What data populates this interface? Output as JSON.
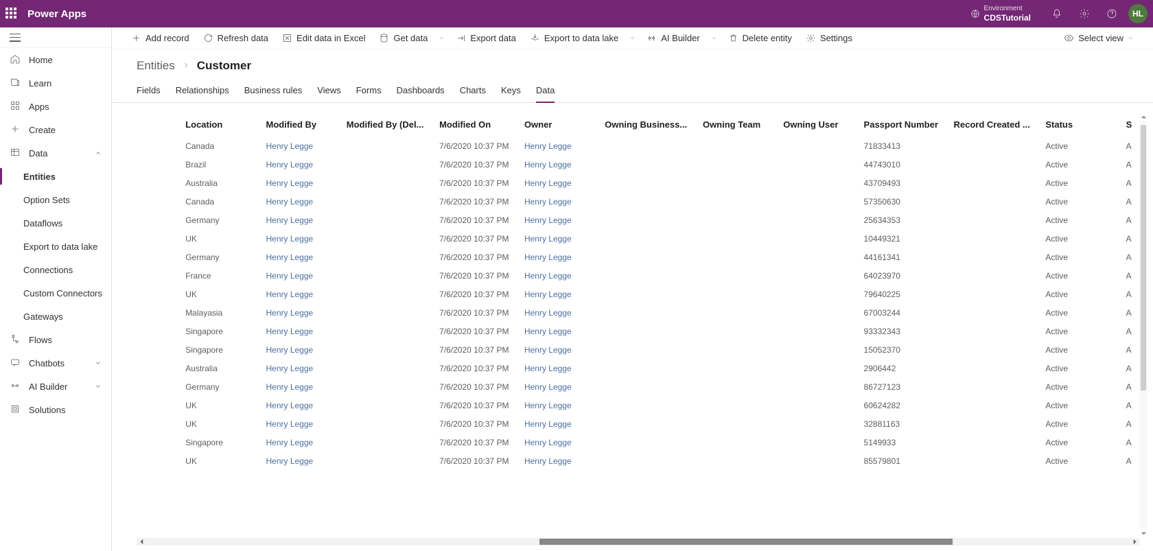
{
  "app_title": "Power Apps",
  "environment": {
    "label": "Environment",
    "name": "CDSTutorial"
  },
  "avatar_initials": "HL",
  "sidebar": {
    "items": [
      {
        "label": "Home"
      },
      {
        "label": "Learn"
      },
      {
        "label": "Apps"
      },
      {
        "label": "Create"
      },
      {
        "label": "Data",
        "expanded": true,
        "children": [
          {
            "label": "Entities",
            "active": true
          },
          {
            "label": "Option Sets"
          },
          {
            "label": "Dataflows"
          },
          {
            "label": "Export to data lake"
          },
          {
            "label": "Connections"
          },
          {
            "label": "Custom Connectors"
          },
          {
            "label": "Gateways"
          }
        ]
      },
      {
        "label": "Flows"
      },
      {
        "label": "Chatbots",
        "chevron": true
      },
      {
        "label": "AI Builder",
        "chevron": true
      },
      {
        "label": "Solutions"
      }
    ]
  },
  "command_bar": {
    "add_record": "Add record",
    "refresh": "Refresh data",
    "edit_excel": "Edit data in Excel",
    "get_data": "Get data",
    "export_data": "Export data",
    "export_lake": "Export to data lake",
    "ai_builder": "AI Builder",
    "delete_entity": "Delete entity",
    "settings": "Settings",
    "select_view": "Select view"
  },
  "breadcrumb": {
    "root": "Entities",
    "current": "Customer"
  },
  "tabs": [
    "Fields",
    "Relationships",
    "Business rules",
    "Views",
    "Forms",
    "Dashboards",
    "Charts",
    "Keys",
    "Data"
  ],
  "active_tab": "Data",
  "columns": [
    "Location",
    "Modified By",
    "Modified By (Del...",
    "Modified On",
    "Owner",
    "Owning Business...",
    "Owning Team",
    "Owning User",
    "Passport Number",
    "Record Created ...",
    "Status",
    "S"
  ],
  "rows": [
    {
      "location": "Canada",
      "modified_by": "Henry Legge",
      "modified_on": "7/6/2020 10:37 PM",
      "owner": "Henry Legge",
      "passport": "71833413",
      "status": "Active",
      "sr": "A"
    },
    {
      "location": "Brazil",
      "modified_by": "Henry Legge",
      "modified_on": "7/6/2020 10:37 PM",
      "owner": "Henry Legge",
      "passport": "44743010",
      "status": "Active",
      "sr": "A"
    },
    {
      "location": "Australia",
      "modified_by": "Henry Legge",
      "modified_on": "7/6/2020 10:37 PM",
      "owner": "Henry Legge",
      "passport": "43709493",
      "status": "Active",
      "sr": "A"
    },
    {
      "location": "Canada",
      "modified_by": "Henry Legge",
      "modified_on": "7/6/2020 10:37 PM",
      "owner": "Henry Legge",
      "passport": "57350630",
      "status": "Active",
      "sr": "A"
    },
    {
      "location": "Germany",
      "modified_by": "Henry Legge",
      "modified_on": "7/6/2020 10:37 PM",
      "owner": "Henry Legge",
      "passport": "25634353",
      "status": "Active",
      "sr": "A"
    },
    {
      "location": "UK",
      "modified_by": "Henry Legge",
      "modified_on": "7/6/2020 10:37 PM",
      "owner": "Henry Legge",
      "passport": "10449321",
      "status": "Active",
      "sr": "A"
    },
    {
      "location": "Germany",
      "modified_by": "Henry Legge",
      "modified_on": "7/6/2020 10:37 PM",
      "owner": "Henry Legge",
      "passport": "44161341",
      "status": "Active",
      "sr": "A"
    },
    {
      "location": "France",
      "modified_by": "Henry Legge",
      "modified_on": "7/6/2020 10:37 PM",
      "owner": "Henry Legge",
      "passport": "64023970",
      "status": "Active",
      "sr": "A"
    },
    {
      "location": "UK",
      "modified_by": "Henry Legge",
      "modified_on": "7/6/2020 10:37 PM",
      "owner": "Henry Legge",
      "passport": "79640225",
      "status": "Active",
      "sr": "A"
    },
    {
      "location": "Malayasia",
      "modified_by": "Henry Legge",
      "modified_on": "7/6/2020 10:37 PM",
      "owner": "Henry Legge",
      "passport": "67003244",
      "status": "Active",
      "sr": "A"
    },
    {
      "location": "Singapore",
      "modified_by": "Henry Legge",
      "modified_on": "7/6/2020 10:37 PM",
      "owner": "Henry Legge",
      "passport": "93332343",
      "status": "Active",
      "sr": "A"
    },
    {
      "location": "Singapore",
      "modified_by": "Henry Legge",
      "modified_on": "7/6/2020 10:37 PM",
      "owner": "Henry Legge",
      "passport": "15052370",
      "status": "Active",
      "sr": "A"
    },
    {
      "location": "Australia",
      "modified_by": "Henry Legge",
      "modified_on": "7/6/2020 10:37 PM",
      "owner": "Henry Legge",
      "passport": "2906442",
      "status": "Active",
      "sr": "A"
    },
    {
      "location": "Germany",
      "modified_by": "Henry Legge",
      "modified_on": "7/6/2020 10:37 PM",
      "owner": "Henry Legge",
      "passport": "86727123",
      "status": "Active",
      "sr": "A"
    },
    {
      "location": "UK",
      "modified_by": "Henry Legge",
      "modified_on": "7/6/2020 10:37 PM",
      "owner": "Henry Legge",
      "passport": "60624282",
      "status": "Active",
      "sr": "A"
    },
    {
      "location": "UK",
      "modified_by": "Henry Legge",
      "modified_on": "7/6/2020 10:37 PM",
      "owner": "Henry Legge",
      "passport": "32881163",
      "status": "Active",
      "sr": "A"
    },
    {
      "location": "Singapore",
      "modified_by": "Henry Legge",
      "modified_on": "7/6/2020 10:37 PM",
      "owner": "Henry Legge",
      "passport": "5149933",
      "status": "Active",
      "sr": "A"
    },
    {
      "location": "UK",
      "modified_by": "Henry Legge",
      "modified_on": "7/6/2020 10:37 PM",
      "owner": "Henry Legge",
      "passport": "85579801",
      "status": "Active",
      "sr": "A"
    }
  ]
}
